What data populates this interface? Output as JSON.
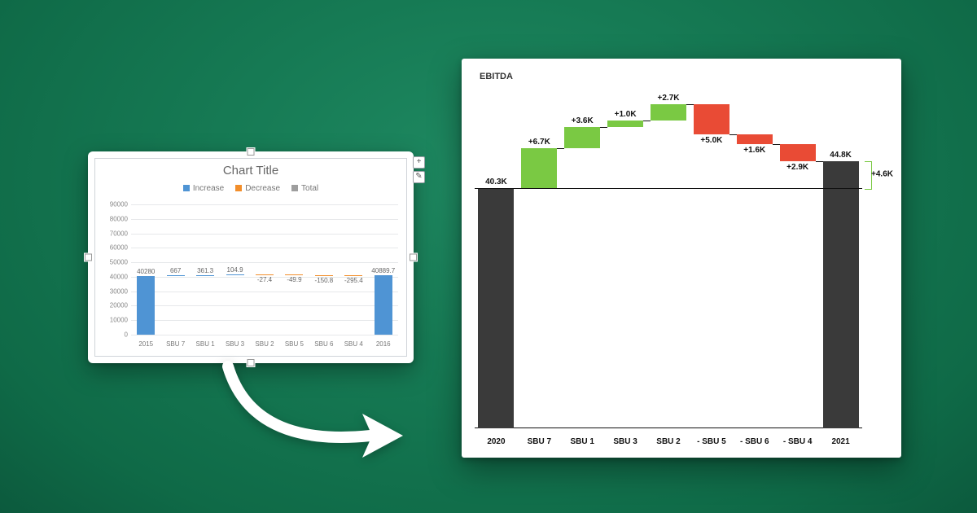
{
  "left_chart": {
    "title": "Chart Title",
    "legend": {
      "increase": "Increase",
      "decrease": "Decrease",
      "total": "Total"
    },
    "side_buttons": {
      "add": "+",
      "brush": "✎"
    }
  },
  "right_chart": {
    "title": "EBITDA",
    "diff_label": "+4.6K"
  },
  "chart_data": [
    {
      "type": "bar",
      "waterfall": true,
      "title": "Chart Title",
      "ylim": [
        0,
        90000
      ],
      "yticks": [
        0,
        10000,
        20000,
        30000,
        40000,
        50000,
        60000,
        70000,
        80000,
        90000
      ],
      "categories": [
        "2015",
        "SBU 7",
        "SBU 1",
        "SBU 3",
        "SBU 2",
        "SBU 5",
        "SBU 6",
        "SBU 4",
        "2016"
      ],
      "roles": [
        "total",
        "increase",
        "increase",
        "increase",
        "decrease",
        "decrease",
        "decrease",
        "decrease",
        "total"
      ],
      "values": [
        40280,
        667,
        361.3,
        104.9,
        -27.4,
        -49.9,
        -150.8,
        -295.4,
        40889.7
      ],
      "value_labels": [
        "40280",
        "667",
        "361.3",
        "104.9",
        "-27.4",
        "-49.9",
        "-150.8",
        "-295.4",
        "40889.7"
      ],
      "legend": [
        "Increase",
        "Decrease",
        "Total"
      ]
    },
    {
      "type": "bar",
      "waterfall": true,
      "title": "EBITDA",
      "categories": [
        "2020",
        "SBU 7",
        "SBU 1",
        "SBU 3",
        "SBU 2",
        "- SBU 5",
        "- SBU 6",
        "- SBU 4",
        "2021"
      ],
      "roles": [
        "total",
        "increase",
        "increase",
        "increase",
        "increase",
        "decrease",
        "decrease",
        "decrease",
        "total"
      ],
      "values_k": [
        40.3,
        6.7,
        3.6,
        1.0,
        2.7,
        -5.0,
        -1.6,
        -2.9,
        44.8
      ],
      "value_labels": [
        "40.3K",
        "+6.7K",
        "+3.6K",
        "+1.0K",
        "+2.7K",
        "+5.0K",
        "+1.6K",
        "+2.9K",
        "44.8K"
      ],
      "difference_k": 4.6,
      "difference_label": "+4.6K"
    }
  ]
}
